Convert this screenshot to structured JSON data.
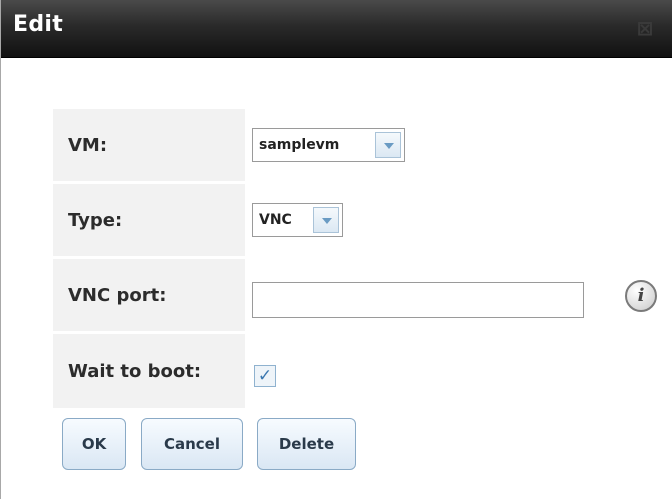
{
  "dialog": {
    "title": "Edit",
    "close_icon": "close-icon"
  },
  "form": {
    "vm_label": "VM:",
    "vm_value": "samplevm",
    "type_label": "Type:",
    "type_value": "VNC",
    "vnc_port_label": "VNC port:",
    "vnc_port_value": "",
    "info_icon": "i",
    "wait_label": "Wait to boot:",
    "wait_checked": true,
    "check_mark": "✓"
  },
  "buttons": {
    "ok": "OK",
    "cancel": "Cancel",
    "delete": "Delete"
  },
  "colors": {
    "titlebar": "#1e1e1e",
    "accent": "#6a9bc3"
  }
}
